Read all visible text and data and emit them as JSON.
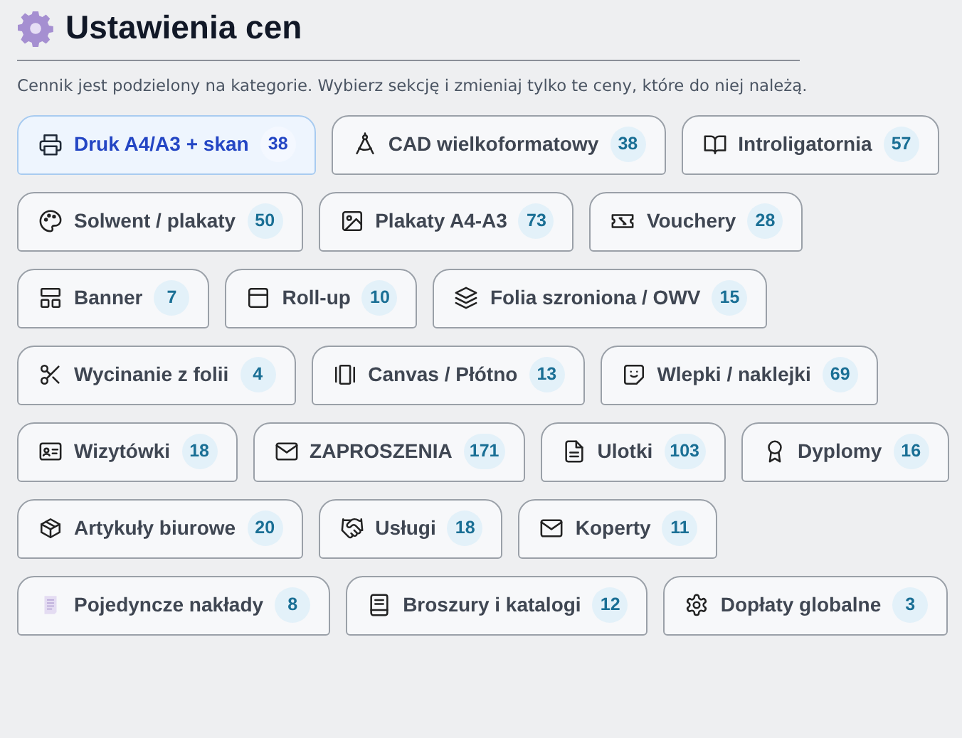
{
  "header": {
    "title": "Ustawienia cen",
    "description": "Cennik jest podzielony na kategorie. Wybierz sekcję i zmieniaj tylko te ceny, które do niej należą."
  },
  "categories": [
    {
      "label": "Druk A4/A3 + skan",
      "count": "38",
      "selected": true
    },
    {
      "label": "CAD wielkoformatowy",
      "count": "38",
      "selected": false
    },
    {
      "label": "Introligatornia",
      "count": "57",
      "selected": false
    },
    {
      "label": "Solwent / plakaty",
      "count": "50",
      "selected": false
    },
    {
      "label": "Plakaty A4-A3",
      "count": "73",
      "selected": false
    },
    {
      "label": "Vouchery",
      "count": "28",
      "selected": false
    },
    {
      "label": "Banner",
      "count": "7",
      "selected": false
    },
    {
      "label": "Roll-up",
      "count": "10",
      "selected": false
    },
    {
      "label": "Folia szroniona / OWV",
      "count": "15",
      "selected": false
    },
    {
      "label": "Wycinanie z folii",
      "count": "4",
      "selected": false
    },
    {
      "label": "Canvas / Płótno",
      "count": "13",
      "selected": false
    },
    {
      "label": "Wlepki / naklejki",
      "count": "69",
      "selected": false
    },
    {
      "label": "Wizytówki",
      "count": "18",
      "selected": false
    },
    {
      "label": "ZAPROSZENIA",
      "count": "171",
      "selected": false
    },
    {
      "label": "Ulotki",
      "count": "103",
      "selected": false
    },
    {
      "label": "Dyplomy",
      "count": "16",
      "selected": false
    },
    {
      "label": "Artykuły biurowe",
      "count": "20",
      "selected": false
    },
    {
      "label": "Usługi",
      "count": "18",
      "selected": false
    },
    {
      "label": "Koperty",
      "count": "11",
      "selected": false
    },
    {
      "label": "Pojedyncze nakłady",
      "count": "8",
      "selected": false
    },
    {
      "label": "Broszury i katalogi",
      "count": "12",
      "selected": false
    },
    {
      "label": "Dopłaty globalne",
      "count": "3",
      "selected": false
    }
  ]
}
